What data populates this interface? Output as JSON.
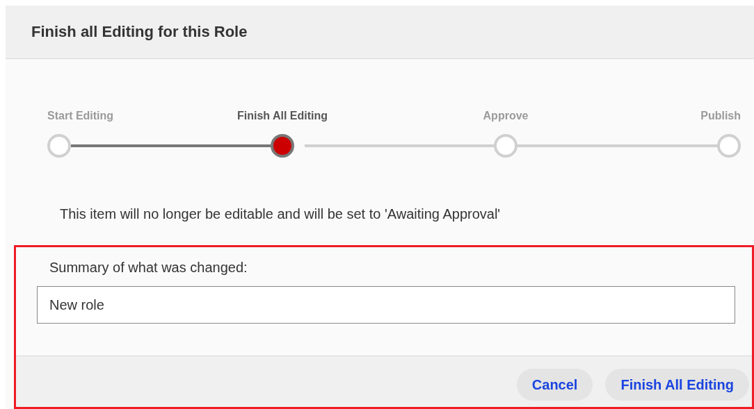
{
  "dialog": {
    "title": "Finish all Editing for this Role"
  },
  "steps": [
    {
      "label": "Start Editing",
      "selected": false
    },
    {
      "label": "Finish All Editing",
      "selected": true
    },
    {
      "label": "Approve",
      "selected": false
    },
    {
      "label": "Publish",
      "selected": false
    }
  ],
  "message": "This item will no longer be editable and will be set to 'Awaiting Approval'",
  "summary": {
    "label": "Summary of what was changed:",
    "value": "New role",
    "highlighted": true
  },
  "buttons": [
    {
      "label": "Cancel"
    },
    {
      "label": "Finish All Editing"
    }
  ]
}
